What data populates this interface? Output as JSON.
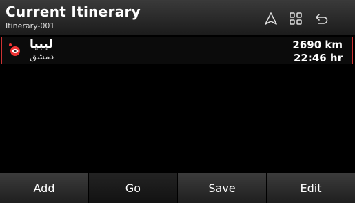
{
  "header": {
    "title": "Current Itinerary",
    "subtitle": "Itinerary-001",
    "icons": [
      "navigation-arrow-icon",
      "grid-menu-icon",
      "back-icon"
    ]
  },
  "itinerary": {
    "items": [
      {
        "name": "ليبيا",
        "subname": "دمشق",
        "distance": "2690 km",
        "time": "22:46 hr"
      }
    ]
  },
  "footer": {
    "buttons": [
      "Add",
      "Go",
      "Save",
      "Edit"
    ]
  },
  "colors": {
    "accent": "#cc3333",
    "background": "#000000"
  }
}
